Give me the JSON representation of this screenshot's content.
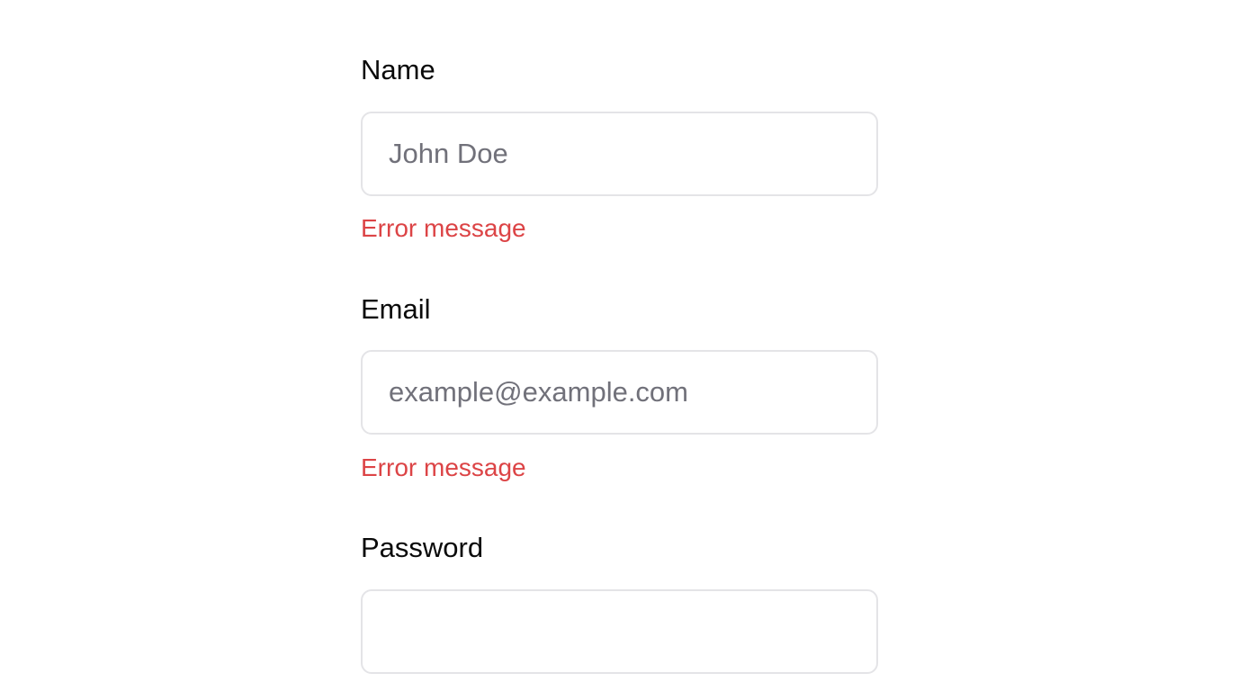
{
  "form": {
    "name": {
      "label": "Name",
      "placeholder": "John Doe",
      "value": "",
      "error": "Error message"
    },
    "email": {
      "label": "Email",
      "placeholder": "example@example.com",
      "value": "",
      "error": "Error message"
    },
    "password": {
      "label": "Password",
      "placeholder": "",
      "value": ""
    }
  },
  "colors": {
    "label": "#0a0a0a",
    "placeholder": "#71717a",
    "border": "#e4e4e7",
    "error": "#dc4446",
    "background": "#ffffff"
  }
}
